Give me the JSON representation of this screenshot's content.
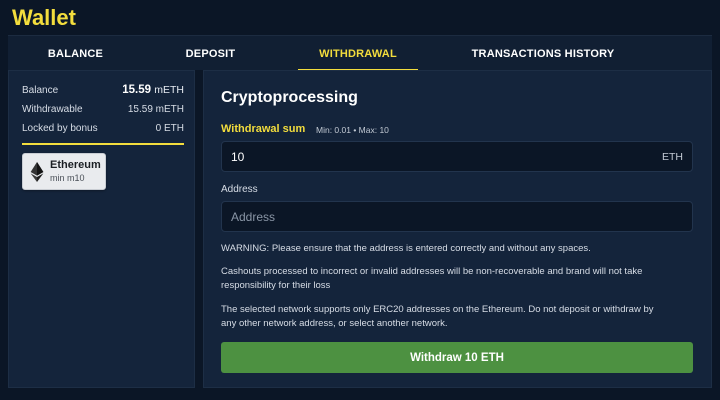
{
  "page": {
    "title": "Wallet"
  },
  "tabs": [
    {
      "label": "BALANCE",
      "active": false
    },
    {
      "label": "DEPOSIT",
      "active": false
    },
    {
      "label": "WITHDRAWAL",
      "active": true
    },
    {
      "label": "TRANSACTIONS HISTORY",
      "active": false
    }
  ],
  "balances": {
    "balance": {
      "label": "Balance",
      "amount": "15.59",
      "unit": "mETH"
    },
    "withdrawable": {
      "label": "Withdrawable",
      "value": "15.59 mETH"
    },
    "locked": {
      "label": "Locked by bonus",
      "value": "0 ETH"
    }
  },
  "methods": [
    {
      "name": "Ethereum",
      "min": "min m10",
      "icon": "ethereum-icon"
    }
  ],
  "form": {
    "title": "Cryptoprocessing",
    "sum_label": "Withdrawal sum",
    "sum_hint": "Min: 0.01 • Max: 10",
    "sum_value": "10",
    "sum_currency": "ETH",
    "address_label": "Address",
    "address_placeholder": "Address",
    "warning": "WARNING: Please ensure that the address is entered correctly and without any spaces.",
    "cashout_note": "Cashouts processed to incorrect or invalid addresses will be non-recoverable and brand will not take responsibility for their loss",
    "network_note": "The selected network supports only ERC20 addresses on the Ethereum. Do not deposit or withdraw by any other network address, or select another network.",
    "submit_label": "Withdraw 10 ETH"
  },
  "colors": {
    "accent": "#f3dd3d",
    "background": "#0b1626",
    "panel": "#14243b",
    "button": "#4d9141"
  }
}
